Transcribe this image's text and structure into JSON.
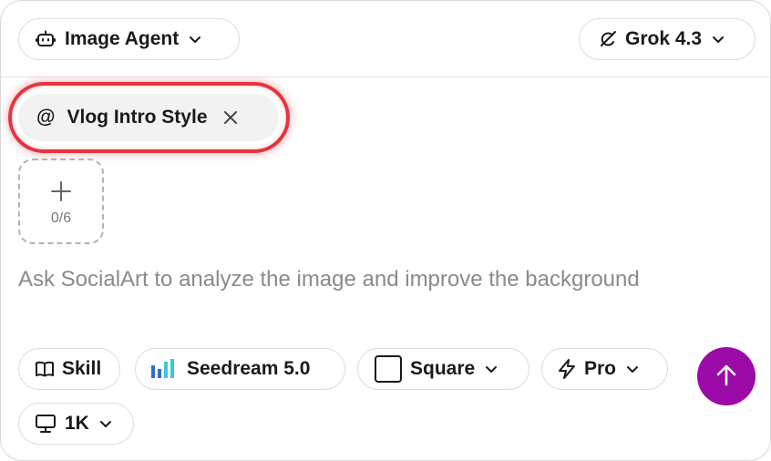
{
  "header": {
    "agent": {
      "label": "Image Agent",
      "icon": "robot-icon"
    },
    "model": {
      "label": "Grok 4.3",
      "icon": "model-icon"
    }
  },
  "reference": {
    "at_symbol": "@",
    "label": "Vlog Intro Style",
    "remove_icon": "close-icon"
  },
  "upload": {
    "icon": "plus-icon",
    "count": "0/6"
  },
  "prompt": {
    "placeholder": "Ask SocialArt to analyze the image and improve the background",
    "value": ""
  },
  "options": {
    "skill": {
      "label": "Skill",
      "icon": "book-icon"
    },
    "image_model": {
      "label": "Seedream 5.0",
      "icon": "seedream-logo-icon"
    },
    "aspect": {
      "label": "Square",
      "icon": "square-icon"
    },
    "quality": {
      "label": "Pro",
      "icon": "lightning-icon"
    },
    "resolution": {
      "label": "1K",
      "icon": "monitor-icon"
    }
  },
  "send": {
    "icon": "arrow-up-icon"
  },
  "colors": {
    "accent": "#9b0aa6",
    "highlight_ring": "#e5343f",
    "border": "#d9d9d9",
    "chip_bg": "#f2f2f2",
    "placeholder_text": "#8a8a8a",
    "seedream_blue": "#2f6fd1",
    "seedream_cyan": "#3cc8d8"
  }
}
